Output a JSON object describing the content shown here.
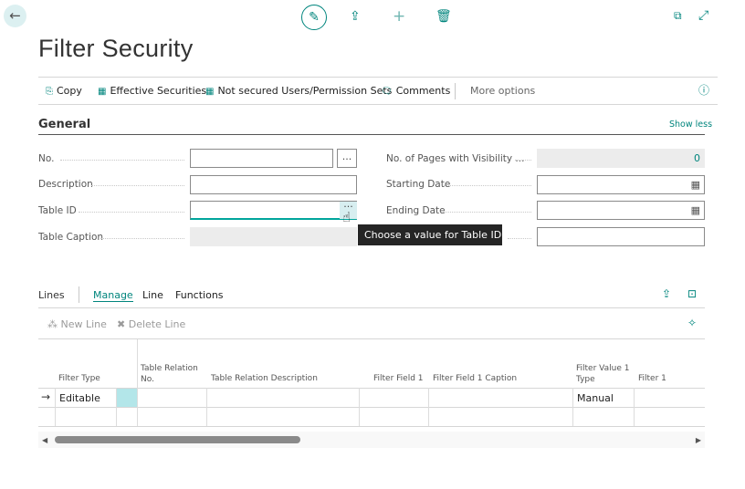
{
  "header": {
    "title": "Filter Security",
    "icons": [
      "back-arrow-icon",
      "edit-icon",
      "share-icon",
      "add-icon",
      "delete-icon",
      "open-new-window-icon",
      "expand-icon"
    ]
  },
  "actions": {
    "copy": "Copy",
    "effective": "Effective Securities",
    "not_secured": "Not secured Users/Permission Sets",
    "comments": "Comments",
    "more": "More options"
  },
  "general": {
    "title": "General",
    "show_less": "Show less",
    "left": [
      {
        "label": "No.",
        "value": ""
      },
      {
        "label": "Description",
        "value": ""
      },
      {
        "label": "Table ID",
        "value": ""
      },
      {
        "label": "Table Caption",
        "value": ""
      }
    ],
    "right": [
      {
        "label": "No. of Pages with Visibility ...",
        "value": "0"
      },
      {
        "label": "Starting Date",
        "value": ""
      },
      {
        "label": "Ending Date",
        "value": ""
      }
    ],
    "assist_button": "...",
    "tooltip": "Choose a value for Table ID"
  },
  "lines": {
    "title": "Lines",
    "tabs": [
      "Manage",
      "Line",
      "Functions"
    ],
    "active_tab": "Manage",
    "new_line": "New Line",
    "delete_line": "Delete Line",
    "columns": [
      "Filter Type",
      "Table Relation No.",
      "Table Relation Description",
      "Filter Field 1",
      "Filter Field 1 Caption",
      "Filter Value 1 Type",
      "Filter 1"
    ],
    "rows": [
      {
        "filter_type": "Editable",
        "filter_value_1_type": "Manual"
      }
    ]
  },
  "colors": {
    "accent": "#00857d",
    "selected_cell": "#b3e6e9"
  }
}
